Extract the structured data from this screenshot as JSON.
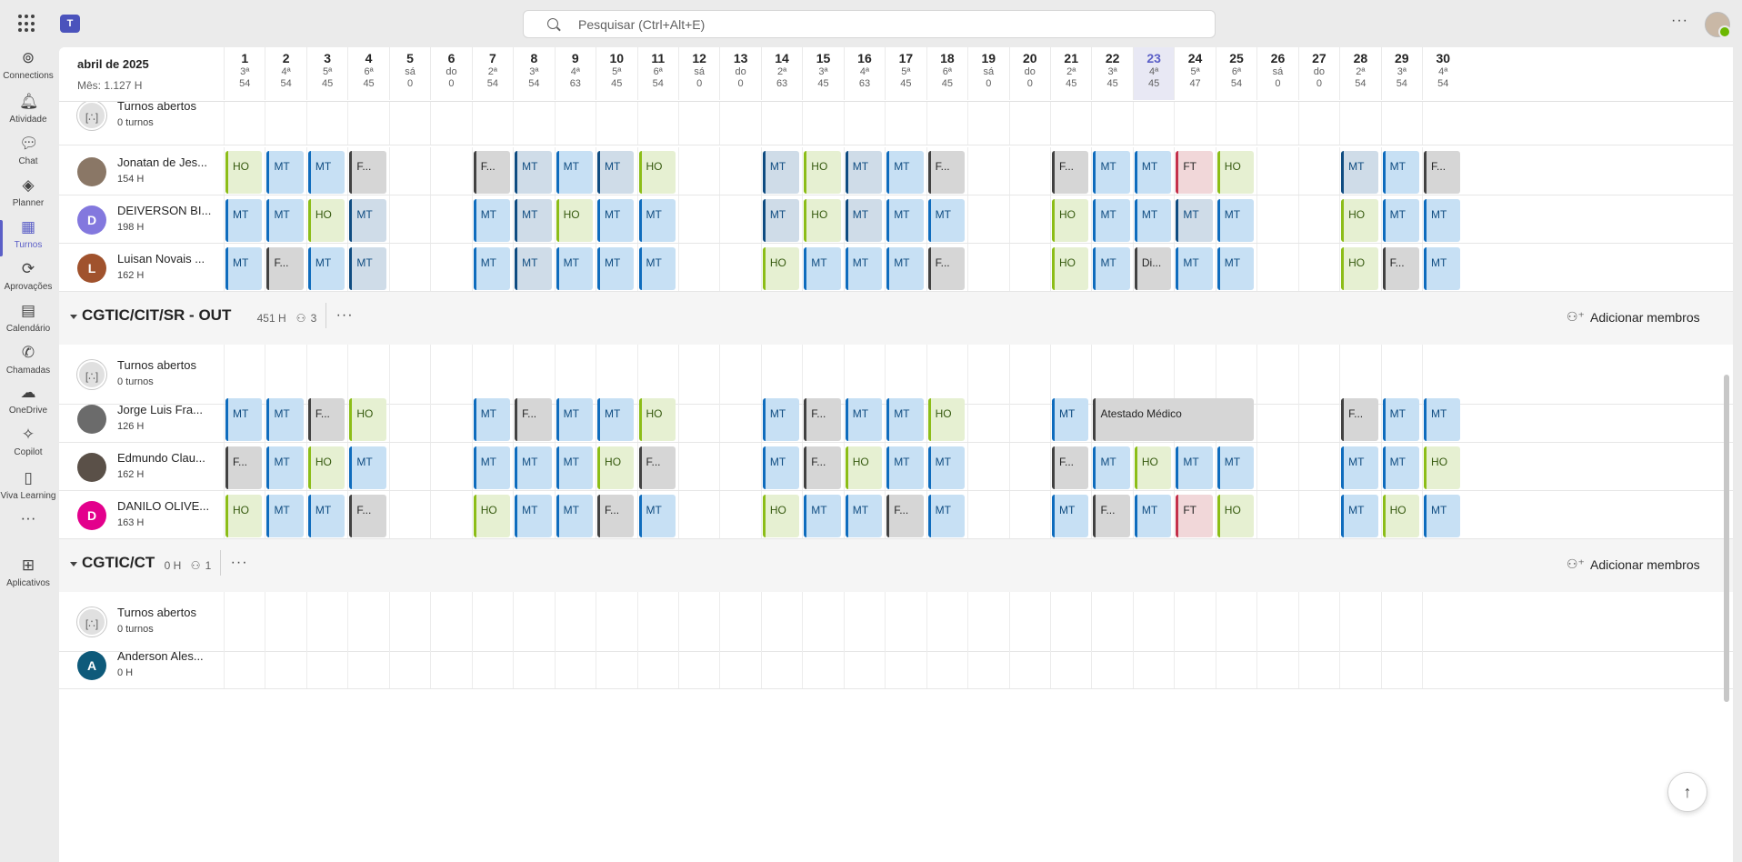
{
  "search": {
    "placeholder": "Pesquisar (Ctrl+Alt+E)"
  },
  "rail": [
    {
      "label": "Connections",
      "icon": "connections-icon"
    },
    {
      "label": "Atividade",
      "icon": "bell-icon"
    },
    {
      "label": "Chat",
      "icon": "chat-icon"
    },
    {
      "label": "Planner",
      "icon": "planner-icon"
    },
    {
      "label": "Turnos",
      "icon": "shifts-icon",
      "active": true
    },
    {
      "label": "Aprovações",
      "icon": "approvals-icon"
    },
    {
      "label": "Calendário",
      "icon": "calendar-icon"
    },
    {
      "label": "Chamadas",
      "icon": "phone-icon"
    },
    {
      "label": "OneDrive",
      "icon": "cloud-icon"
    },
    {
      "label": "Copilot",
      "icon": "copilot-icon"
    },
    {
      "label": "Viva Learning",
      "icon": "learning-icon"
    },
    {
      "label": "",
      "icon": "more-icon"
    },
    {
      "label": "Aplicativos",
      "icon": "add-apps-icon"
    }
  ],
  "header": {
    "month": "abril de 2025",
    "month_hours": "Mês: 1.127 H",
    "today_index": 22
  },
  "days": [
    [
      "1",
      "3ª",
      "54"
    ],
    [
      "2",
      "4ª",
      "54"
    ],
    [
      "3",
      "5ª",
      "45"
    ],
    [
      "4",
      "6ª",
      "45"
    ],
    [
      "5",
      "sá",
      "0"
    ],
    [
      "6",
      "do",
      "0"
    ],
    [
      "7",
      "2ª",
      "54"
    ],
    [
      "8",
      "3ª",
      "54"
    ],
    [
      "9",
      "4ª",
      "63"
    ],
    [
      "10",
      "5ª",
      "45"
    ],
    [
      "11",
      "6ª",
      "54"
    ],
    [
      "12",
      "sá",
      "0"
    ],
    [
      "13",
      "do",
      "0"
    ],
    [
      "14",
      "2ª",
      "63"
    ],
    [
      "15",
      "3ª",
      "45"
    ],
    [
      "16",
      "4ª",
      "63"
    ],
    [
      "17",
      "5ª",
      "45"
    ],
    [
      "18",
      "6ª",
      "45"
    ],
    [
      "19",
      "sá",
      "0"
    ],
    [
      "20",
      "do",
      "0"
    ],
    [
      "21",
      "2ª",
      "45"
    ],
    [
      "22",
      "3ª",
      "45"
    ],
    [
      "23",
      "4ª",
      "45"
    ],
    [
      "24",
      "5ª",
      "47"
    ],
    [
      "25",
      "6ª",
      "54"
    ],
    [
      "26",
      "sá",
      "0"
    ],
    [
      "27",
      "do",
      "0"
    ],
    [
      "28",
      "2ª",
      "54"
    ],
    [
      "29",
      "3ª",
      "54"
    ],
    [
      "30",
      "4ª",
      "54"
    ]
  ],
  "groups": [
    {
      "title": "",
      "rows": [
        {
          "type": "open",
          "name": "Turnos abertos",
          "sub": "0 turnos"
        },
        {
          "name": "Jonatan de Jes...",
          "hours": "154 H",
          "avatar": "",
          "color": "#8a7766",
          "shifts": [
            "HO",
            "MT",
            "MT",
            "F...",
            "",
            "",
            "F...",
            "MTd",
            "MT",
            "MTd",
            "HO",
            "",
            "",
            "MTd",
            "HO",
            "MTd",
            "MT",
            "F...",
            "",
            "",
            "F...",
            "MT",
            "MT",
            "FT",
            "HO",
            "",
            "",
            "MTd",
            "MT",
            "F..."
          ]
        },
        {
          "name": "DEIVERSON BI...",
          "hours": "198 H",
          "avatar": "D",
          "color": "#8378de",
          "shifts": [
            "MT",
            "MT",
            "HO",
            "MTd",
            "",
            "",
            "MT",
            "MTd",
            "HO",
            "MT",
            "MT",
            "",
            "",
            "MTd",
            "HO",
            "MTd",
            "MT",
            "MT",
            "",
            "",
            "HO",
            "MT",
            "MT",
            "MTd",
            "MT",
            "",
            "",
            "HO",
            "MT",
            "MT"
          ]
        },
        {
          "name": "Luisan Novais ...",
          "hours": "162 H",
          "avatar": "L",
          "color": "#a0522d",
          "shifts": [
            "MT",
            "F...",
            "MT",
            "MTd",
            "",
            "",
            "MT",
            "MTd",
            "MT",
            "MT",
            "MT",
            "",
            "",
            "HO",
            "MT",
            "MT",
            "MT",
            "F...",
            "",
            "",
            "HO",
            "MT",
            "Di...",
            "MT",
            "MT",
            "",
            "",
            "HO",
            "F...",
            "MT"
          ]
        }
      ]
    },
    {
      "title": "CGTIC/CIT/SR - OUT",
      "hours": "451 H",
      "members": "3",
      "add_label": "Adicionar membros",
      "rows": [
        {
          "type": "open",
          "name": "Turnos abertos",
          "sub": "0 turnos"
        },
        {
          "name": "Jorge Luis Fra...",
          "hours": "126 H",
          "avatar": "",
          "color": "#6b6b6b",
          "shifts": [
            "MT",
            "MT",
            "F...",
            "HO",
            "",
            "",
            "MT",
            "F...",
            "MT",
            "MT",
            "HO",
            "",
            "",
            "MT",
            "F...",
            "MT",
            "MT",
            "HO",
            "",
            "",
            "MT",
            "Atestado Médico",
            "",
            "",
            "",
            "",
            "",
            "F...",
            "MT",
            "MT"
          ]
        },
        {
          "name": "Edmundo Clau...",
          "hours": "162 H",
          "avatar": "",
          "color": "#5a5048",
          "shifts": [
            "F...",
            "MT",
            "HO",
            "MT",
            "",
            "",
            "MT",
            "MT",
            "MT",
            "HO",
            "F...",
            "",
            "",
            "MT",
            "F...",
            "HO",
            "MT",
            "MT",
            "",
            "",
            "F...",
            "MT",
            "HO",
            "MT",
            "MT",
            "",
            "",
            "MT",
            "MT",
            "HO"
          ]
        },
        {
          "name": "DANILO OLIVE...",
          "hours": "163 H",
          "avatar": "D",
          "color": "#e3008c",
          "shifts": [
            "HO",
            "MT",
            "MT",
            "F...",
            "",
            "",
            "HO",
            "MT",
            "MT",
            "F...",
            "MT",
            "",
            "",
            "HO",
            "MT",
            "MT",
            "F...",
            "MT",
            "",
            "",
            "MT",
            "F...",
            "MT",
            "FT",
            "HO",
            "",
            "",
            "MT",
            "HO",
            "MT"
          ]
        }
      ]
    },
    {
      "title": "CGTIC/CT",
      "hours": "0 H",
      "members": "1",
      "add_label": "Adicionar membros",
      "rows": [
        {
          "type": "open",
          "name": "Turnos abertos",
          "sub": "0 turnos"
        },
        {
          "name": "Anderson Ales...",
          "hours": "0 H",
          "avatar": "A",
          "color": "#0e5a7a",
          "shifts": []
        }
      ]
    }
  ],
  "scroll_up_label": "↑"
}
